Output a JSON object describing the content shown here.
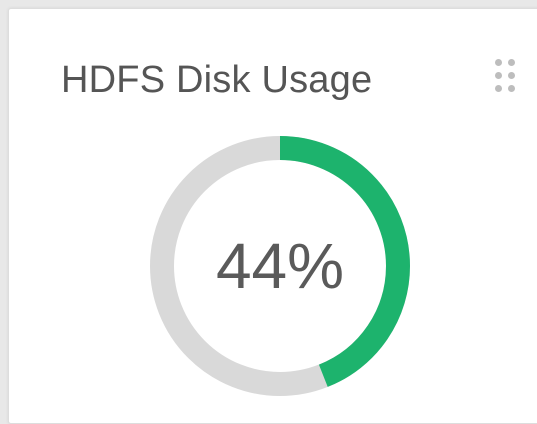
{
  "widget": {
    "title": "HDFS Disk Usage",
    "menu_icon": "drag-handle-dots-icon",
    "usage": {
      "value_label": "44%",
      "percent": 44
    }
  },
  "colors": {
    "used": "#1db36d",
    "remaining": "#d9d9d9",
    "title_text": "#555555",
    "value_text": "#5a5a5a",
    "card_background": "#ffffff"
  }
}
